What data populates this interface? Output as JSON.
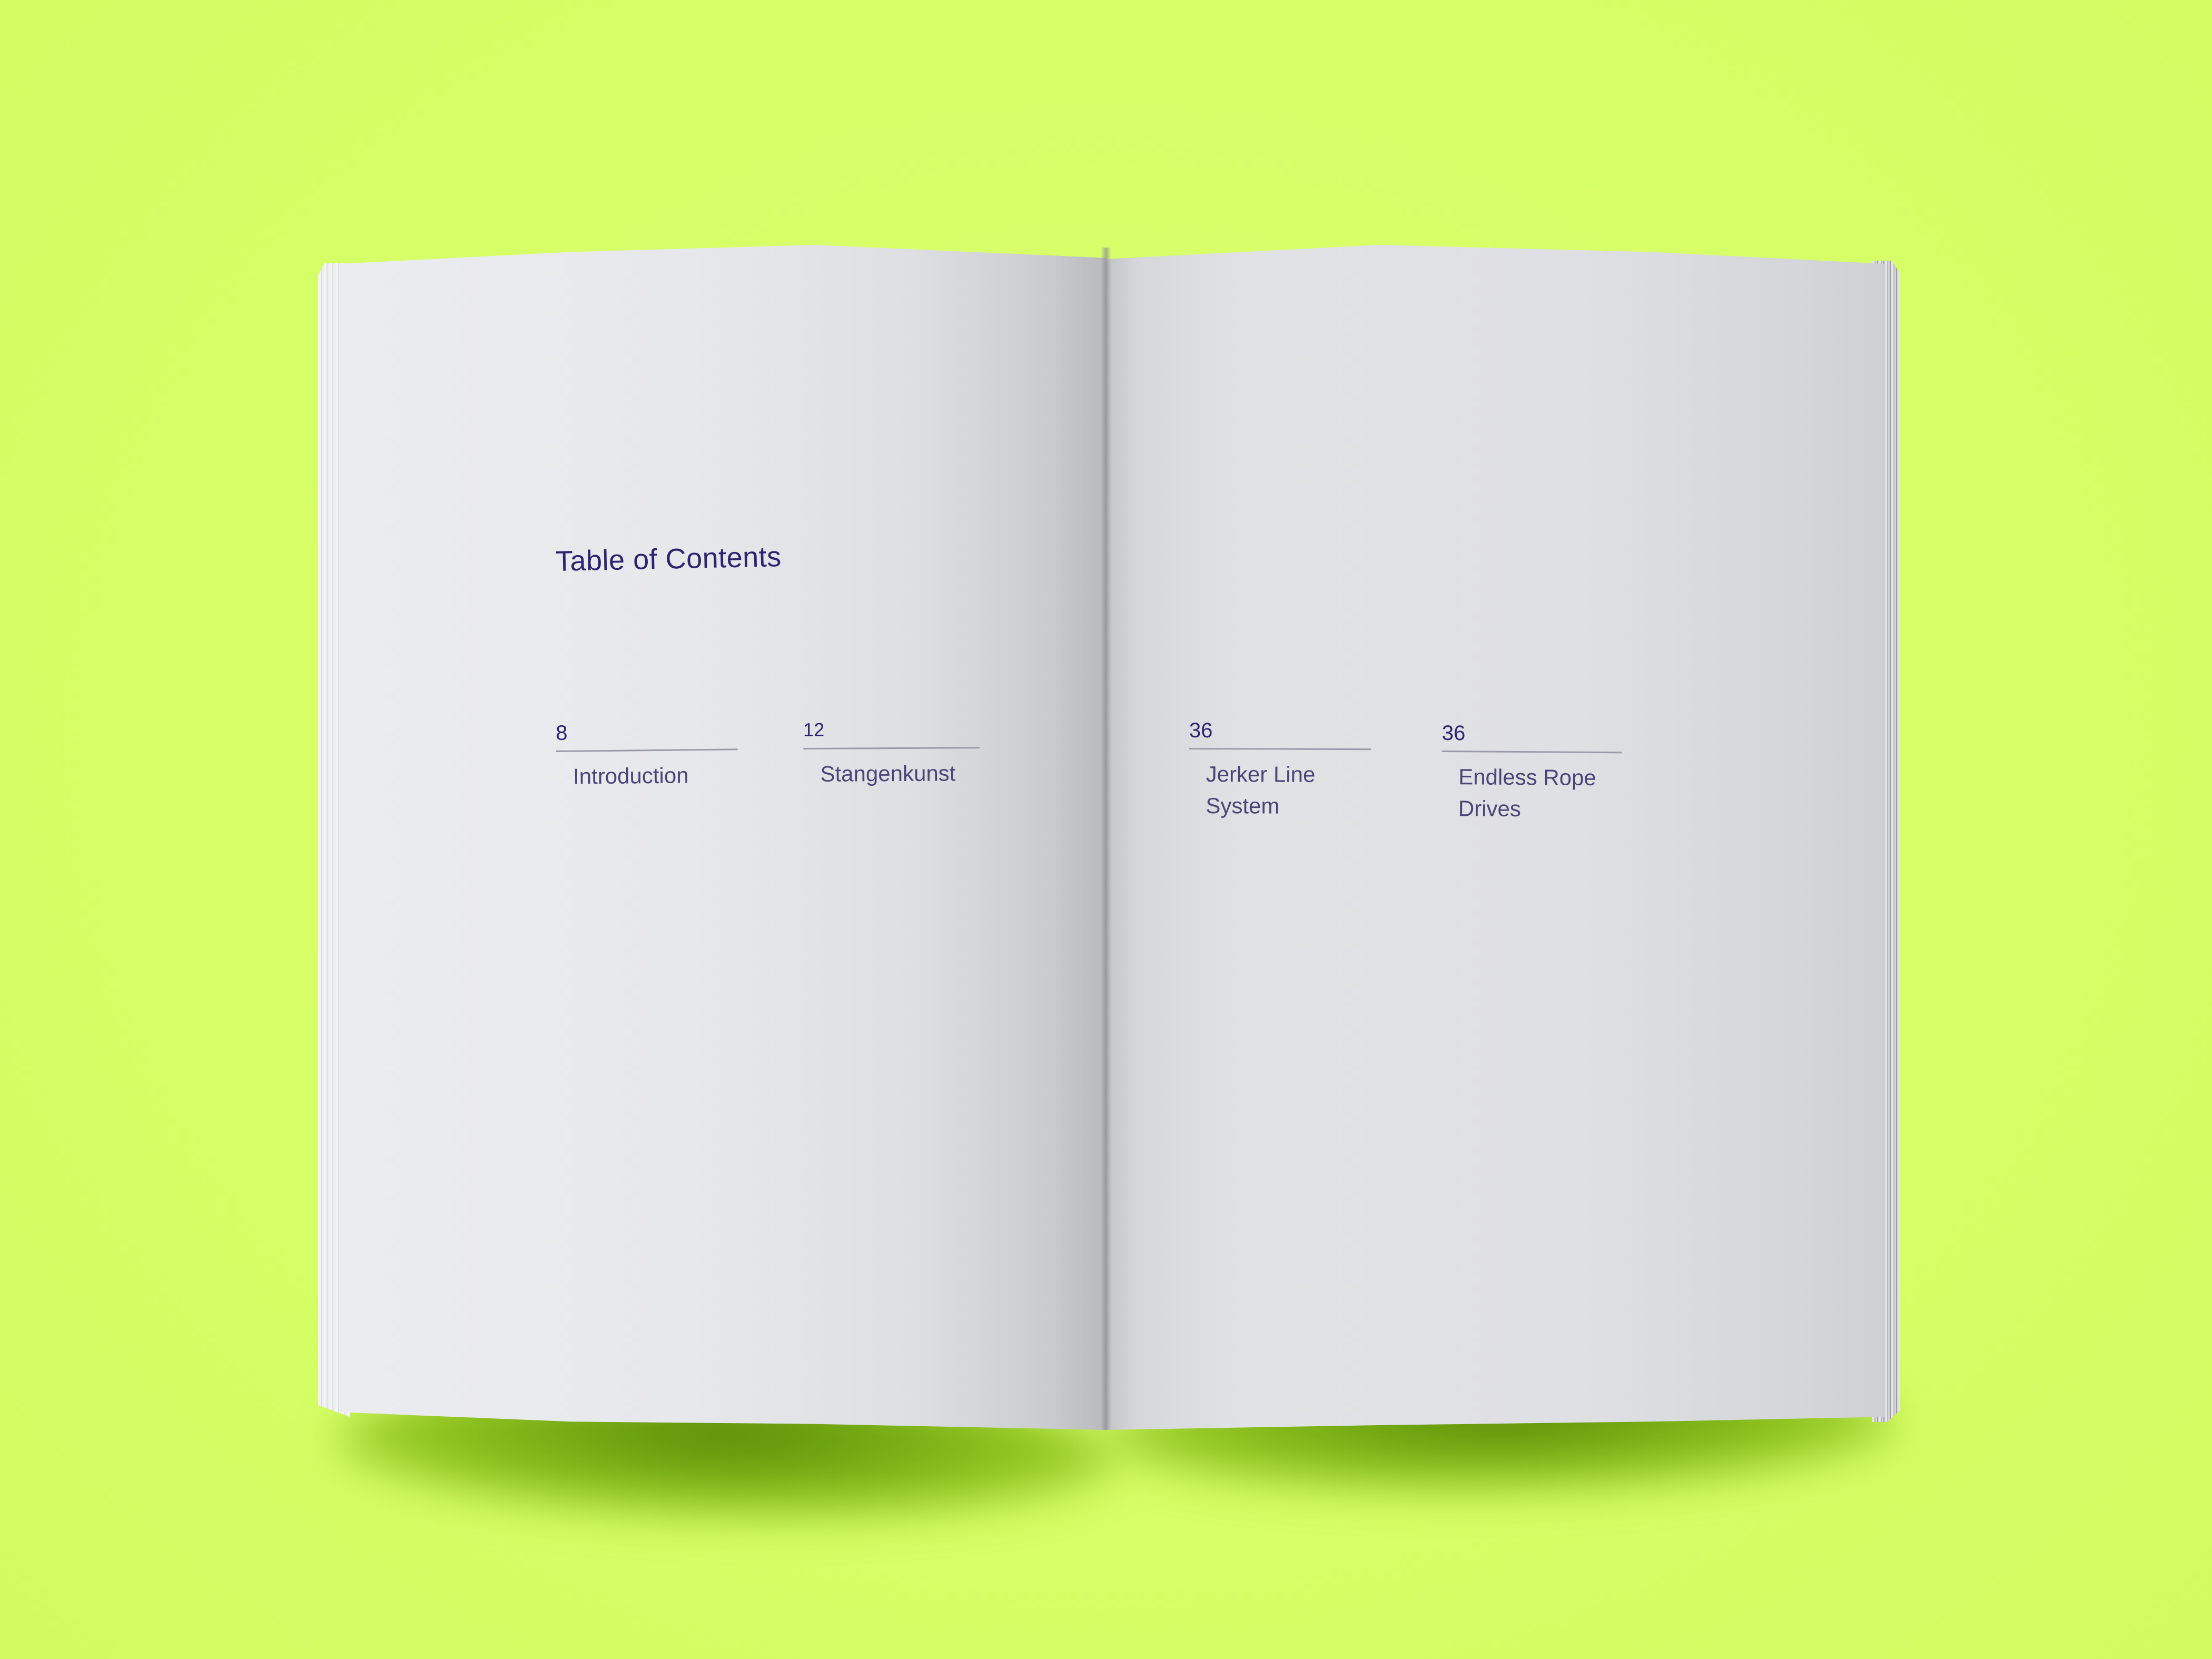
{
  "toc": {
    "title": "Table of  Contents",
    "entries": [
      {
        "page": "8",
        "label": "Introduction"
      },
      {
        "page": "12",
        "label": "Stangenkunst"
      },
      {
        "page": "36",
        "label_line1": "Jerker Line",
        "label_line2": "System"
      },
      {
        "page": "36",
        "label_line1": "Endless Rope",
        "label_line2": "Drives"
      }
    ]
  },
  "colors": {
    "background": "#d9ff6a",
    "text": "#2d2470",
    "paper": "#e7e8eb"
  }
}
